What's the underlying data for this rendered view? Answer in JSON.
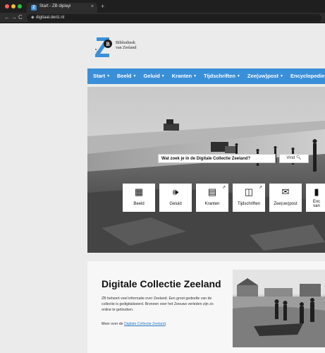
{
  "browser": {
    "tab_title": "Start - ZB diplayi",
    "tab_close": "×",
    "new_tab": "+",
    "nav_back": "←",
    "nav_forward": "→",
    "nav_reload": "C",
    "url": "digitaal.deriz.nl"
  },
  "header": {
    "logo_line1": "Bibliotheek",
    "logo_line2": "van Zeeland"
  },
  "nav": {
    "items": [
      {
        "label": "Start",
        "has_caret": true
      },
      {
        "label": "Beeld",
        "has_caret": true
      },
      {
        "label": "Geluid",
        "has_caret": true
      },
      {
        "label": "Kranten",
        "has_caret": true
      },
      {
        "label": "Tijdschriften",
        "has_caret": true
      },
      {
        "label": "Zee(uw)post",
        "has_caret": true
      },
      {
        "label": "Encyclopedie van Ze",
        "has_caret": false
      }
    ]
  },
  "hero": {
    "search_placeholder": "Wat zoek je in de Digitale Collectie Zeeland?",
    "search_button": "Vind 🔍︎"
  },
  "tiles": [
    {
      "label": "Beeld",
      "icon": "image-icon",
      "external": false
    },
    {
      "label": "Geluid",
      "icon": "speaker-icon",
      "external": false
    },
    {
      "label": "Kranten",
      "icon": "newspaper-icon",
      "external": true
    },
    {
      "label": "Tijdschriften",
      "icon": "book-icon",
      "external": true
    },
    {
      "label": "Zee(uw)post",
      "icon": "envelope-icon",
      "external": false
    },
    {
      "label": "Enc\nvan",
      "icon": "encyclopedia-icon",
      "external": false
    }
  ],
  "about": {
    "title": "Digitale Collectie Zeeland",
    "body": "ZB beheert veel informatie over Zeeland. Een groot gedeelte van de collectie is gedigitaliseerd. Bronnen over het Zeeuws verleden zijn zo online te gebruiken.",
    "more_prefix": "Meer over de ",
    "more_link": "Digitale Collectie Zeeland",
    "more_suffix": "."
  },
  "colors": {
    "nav_blue": "#3a8fd9",
    "link_blue": "#2a7ac5"
  }
}
